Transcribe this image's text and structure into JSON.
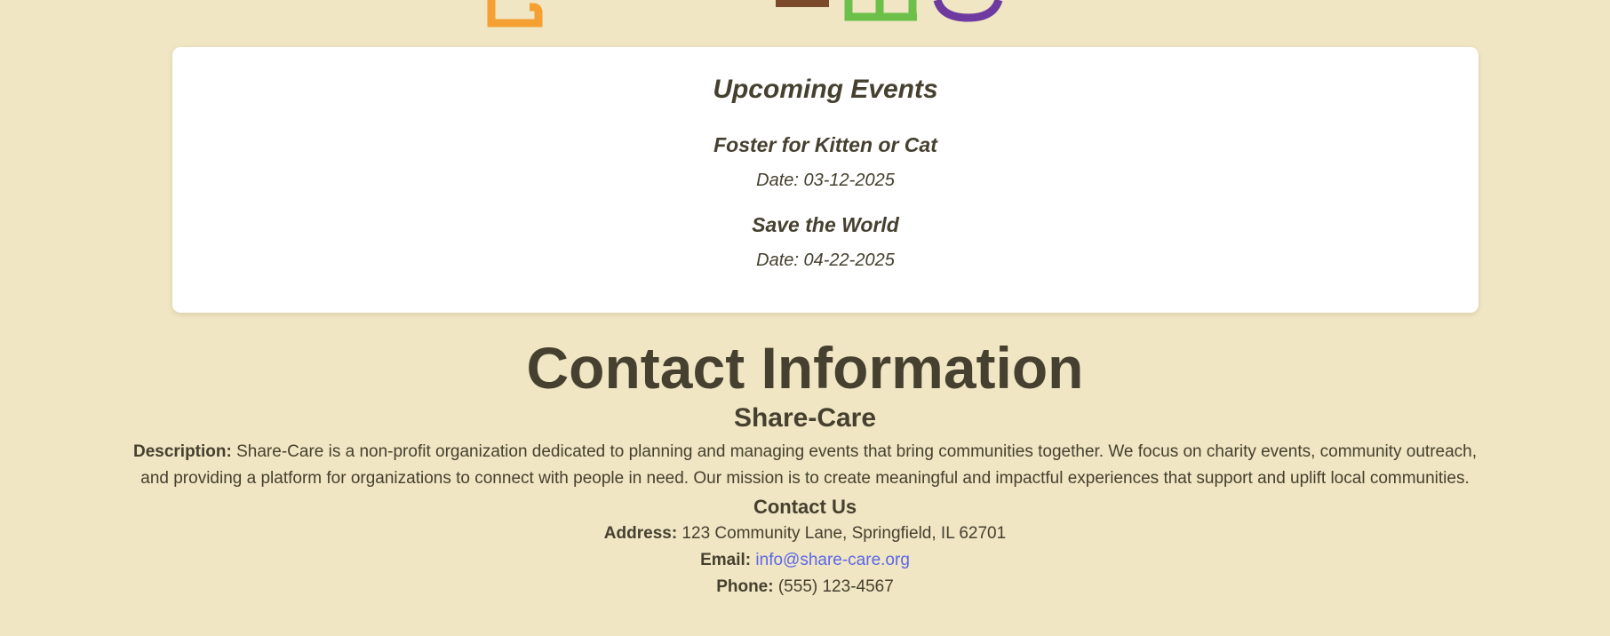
{
  "colors": {
    "page_background": "#f0e6c4",
    "card_background": "#ffffff",
    "text": "#45402f",
    "link": "#5b67e8",
    "logo_orange": "#f5a032",
    "logo_brown": "#7a4a2a",
    "logo_green": "#6cc04a",
    "logo_purple": "#6e3aa0"
  },
  "upcoming_events": {
    "title": "Upcoming Events",
    "events": [
      {
        "name": "Foster for Kitten or Cat",
        "date": "Date: 03-12-2025"
      },
      {
        "name": "Save the World",
        "date": "Date: 04-22-2025"
      }
    ]
  },
  "contact": {
    "title": "Contact Information",
    "org_name": "Share-Care",
    "description_label": "Description:",
    "description_text": " Share-Care is a non-profit organization dedicated to planning and managing events that bring communities together. We focus on charity events, community outreach, and providing a platform for organizations to connect with people in need. Our mission is to create meaningful and impactful experiences that support and uplift local communities.",
    "contact_us_heading": "Contact Us",
    "address_label": "Address:",
    "address_value": " 123 Community Lane, Springfield, IL 62701",
    "email_label": "Email:",
    "email_value": "info@share-care.org",
    "phone_label": "Phone:",
    "phone_value": " (555) 123-4567"
  }
}
